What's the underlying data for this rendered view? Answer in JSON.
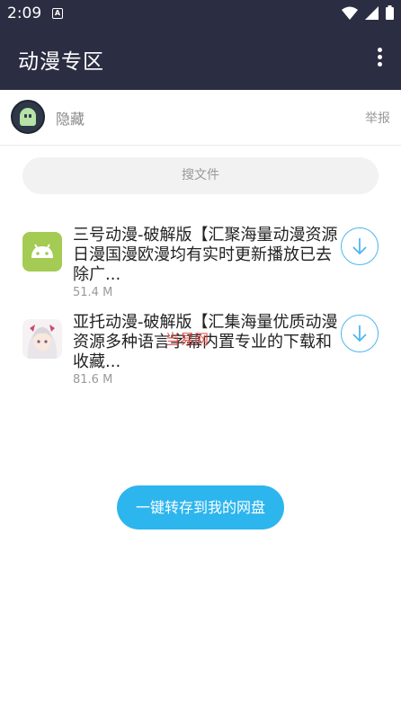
{
  "status_bar": {
    "time": "2:09",
    "a_badge": "A",
    "icons": [
      "wifi-icon",
      "signal-icon",
      "battery-icon"
    ]
  },
  "app_bar": {
    "title": "动漫专区",
    "more_icon": "more-vertical-icon"
  },
  "owner": {
    "name": "隐藏",
    "report_label": "举报"
  },
  "search": {
    "placeholder": "搜文件"
  },
  "files": [
    {
      "title": "三号动漫-破解版【汇聚海量动漫资源日漫国漫欧漫均有实时更新播放已去除广...",
      "size": "51.4 M",
      "icon": "android-app-icon"
    },
    {
      "title": "亚托动漫-破解版【汇集海量优质动漫资源多种语言字幕内置专业的下载和收藏...",
      "size": "81.6 M",
      "icon": "anime-girl-app-icon"
    }
  ],
  "watermark": "当易网",
  "save_button": "一键转存到我的网盘",
  "colors": {
    "header_bg": "#2b2d42",
    "accent": "#2db5ee",
    "download_ring": "#4fb6ee"
  }
}
